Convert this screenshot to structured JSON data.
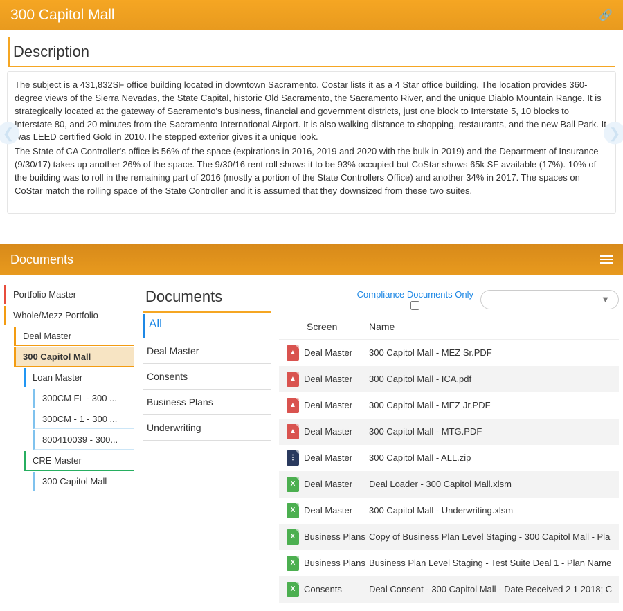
{
  "header": {
    "title": "300 Capitol Mall"
  },
  "description": {
    "heading": "Description",
    "para1": "The subject is a 431,832SF office building located in downtown Sacramento.  Costar lists it as a 4 Star office building.   The location provides 360-degree views of the Sierra Nevadas, the State Capital, historic Old Sacramento, the Sacramento River, and the unique Diablo Mountain Range. It is strategically located at the gateway of Sacramento's business, financial and government districts, just one block to Interstate 5, 10 blocks to Interstate 80, and 20 minutes from the Sacramento International Airport.  It is also walking distance to shopping, restaurants, and the new Ball Park.  It was LEED certified Gold in 2010.The stepped exterior gives it a unique look.",
    "para2": "The State of CA Controller's office is 56% of the space (expirations in 2016, 2019 and 2020 with the bulk in 2019) and the Department of Insurance (9/30/17) takes up another 26% of the space.  The 9/30/16 rent roll shows it to be 93% occupied but CoStar shows 65k SF available (17%).  10% of the building was to roll in the remaining part of 2016 (mostly a portion of the State Controllers Office) and another 34% in 2017.  The spaces on CoStar match the rolling space of the State Controller and it is assumed that they downsized from these two suites."
  },
  "documents": {
    "panelTitle": "Documents",
    "innerTitle": "Documents",
    "complianceLabel": "Compliance Documents Only",
    "tree": [
      {
        "label": "Portfolio Master",
        "level": 0,
        "color": "c-red"
      },
      {
        "label": "Whole/Mezz Portfolio",
        "level": 0,
        "color": "c-oranger"
      },
      {
        "label": "Deal Master",
        "level": 1,
        "color": "c-orange"
      },
      {
        "label": "300 Capitol Mall",
        "level": 1,
        "color": "c-orange",
        "selected": true
      },
      {
        "label": "Loan Master",
        "level": 2,
        "color": "c-blue"
      },
      {
        "label": "300CM FL - 300 ...",
        "level": 3,
        "color": "c-bluel"
      },
      {
        "label": "300CM - 1 - 300 ...",
        "level": 3,
        "color": "c-bluel"
      },
      {
        "label": "800410039 - 300...",
        "level": 3,
        "color": "c-bluel"
      },
      {
        "label": "CRE Master",
        "level": 2,
        "color": "c-green"
      },
      {
        "label": "300 Capitol Mall",
        "level": 3,
        "color": "c-bluel"
      }
    ],
    "categories": [
      {
        "label": "All",
        "active": true
      },
      {
        "label": "Deal Master"
      },
      {
        "label": "Consents"
      },
      {
        "label": "Business Plans"
      },
      {
        "label": "Underwriting"
      }
    ],
    "columns": {
      "screen": "Screen",
      "name": "Name"
    },
    "rows": [
      {
        "type": "pdf",
        "screen": "Deal Master",
        "name": "300 Capitol Mall - MEZ Sr.PDF"
      },
      {
        "type": "pdf",
        "screen": "Deal Master",
        "name": "300 Capitol Mall - ICA.pdf"
      },
      {
        "type": "pdf",
        "screen": "Deal Master",
        "name": "300 Capitol Mall - MEZ Jr.PDF"
      },
      {
        "type": "pdf",
        "screen": "Deal Master",
        "name": "300 Capitol Mall - MTG.PDF"
      },
      {
        "type": "zip",
        "screen": "Deal Master",
        "name": "300 Capitol Mall - ALL.zip"
      },
      {
        "type": "xls",
        "screen": "Deal Master",
        "name": "Deal Loader - 300 Capitol Mall.xlsm"
      },
      {
        "type": "xls",
        "screen": "Deal Master",
        "name": "300 Capitol Mall - Underwriting.xlsm"
      },
      {
        "type": "xls",
        "screen": "Business Plans",
        "name": "Copy of Business Plan Level Staging - 300 Capitol Mall - Pla"
      },
      {
        "type": "xls",
        "screen": "Business Plans",
        "name": "Business Plan Level Staging - Test Suite Deal 1 - Plan Name"
      },
      {
        "type": "xls",
        "screen": "Consents",
        "name": "Deal Consent - 300 Capitol Mall - Date Received 2 1 2018; C"
      }
    ]
  }
}
